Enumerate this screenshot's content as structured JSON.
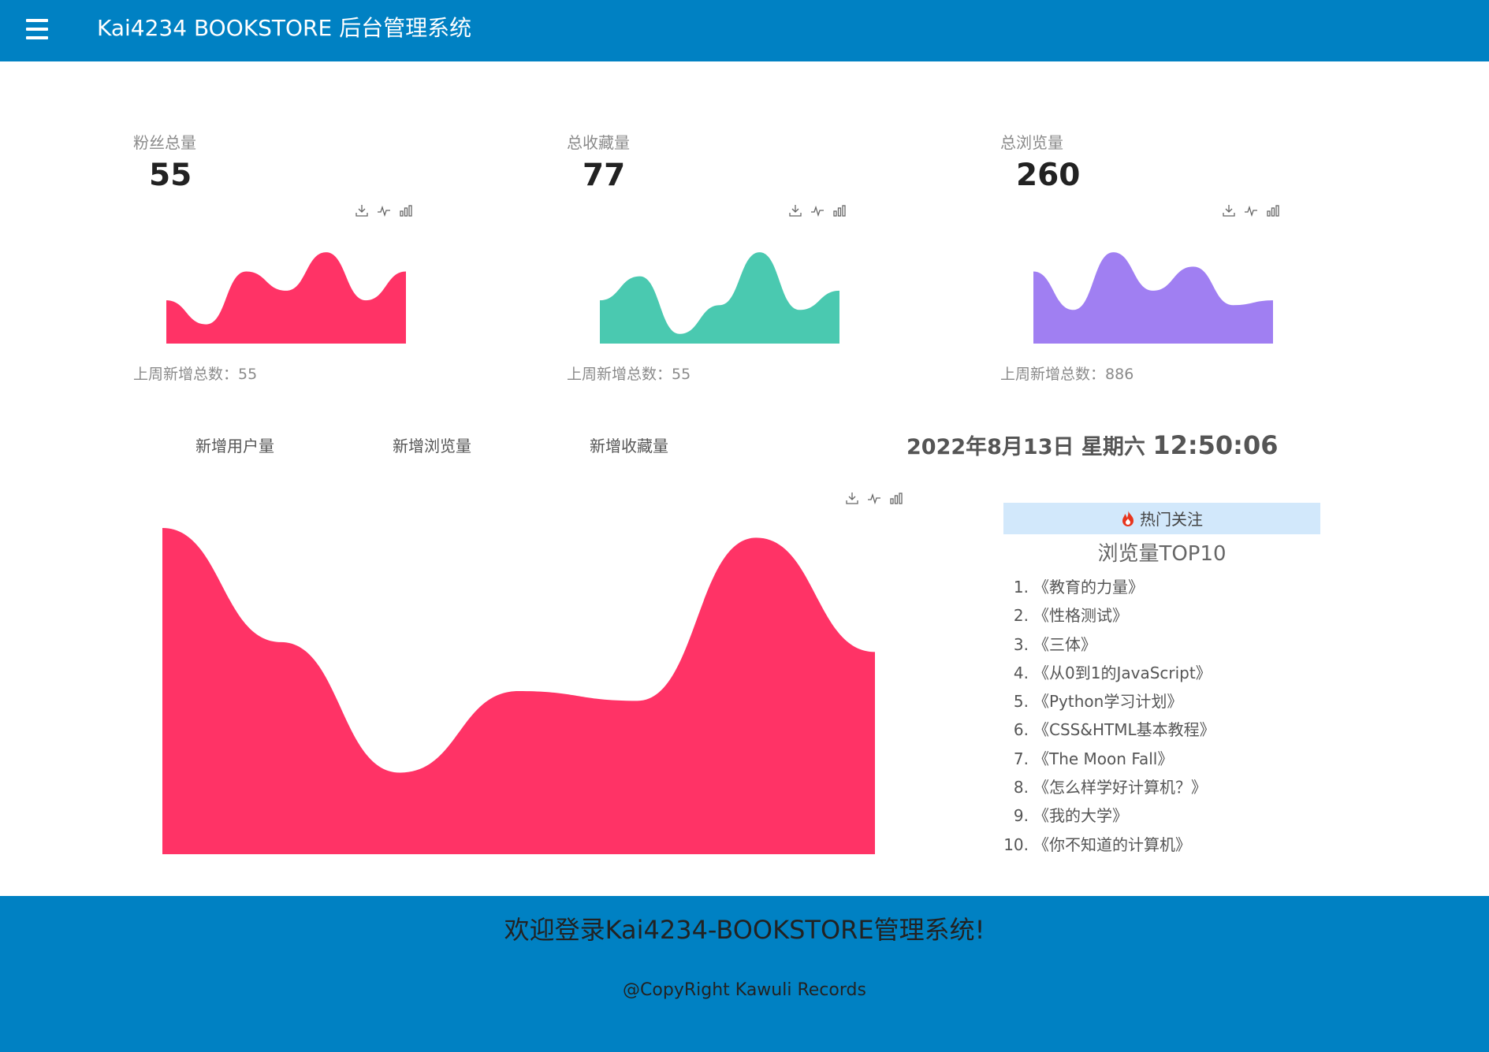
{
  "header": {
    "title": "Kai4234 BOOKSTORE 后台管理系统",
    "menu_icon": "hamburger-menu-icon"
  },
  "stats": [
    {
      "label": "粉丝总量",
      "value": "55",
      "foot_label": "上周新增总数：",
      "foot_value": "55",
      "color": "#ff3366",
      "trend": [
        0.45,
        0.2,
        0.75,
        0.55,
        0.95,
        0.45,
        0.75
      ]
    },
    {
      "label": "总收藏量",
      "value": "77",
      "foot_label": "上周新增总数：",
      "foot_value": "55",
      "color": "#4ac9b0",
      "trend": [
        0.45,
        0.7,
        0.1,
        0.4,
        0.95,
        0.35,
        0.55
      ]
    },
    {
      "label": "总浏览量",
      "value": "260",
      "foot_label": "上周新增总数：",
      "foot_value": "886",
      "color": "#a07ff2",
      "trend": [
        0.75,
        0.35,
        0.95,
        0.55,
        0.8,
        0.4,
        0.45
      ]
    }
  ],
  "toolbox_icons": [
    "download-icon",
    "line-chart-icon",
    "bar-chart-icon"
  ],
  "tabs": [
    "新增用户量",
    "新增浏览量",
    "新增收藏量"
  ],
  "datetime": {
    "date": "2022年8月13日 星期六",
    "time": "12:50:06"
  },
  "chart_data": {
    "type": "area",
    "title": "",
    "series": [
      {
        "values": [
          1.0,
          0.65,
          0.25,
          0.5,
          0.47,
          0.97,
          0.62
        ]
      }
    ],
    "color": "#ff3366",
    "ylim": [
      0,
      1
    ],
    "grid": false
  },
  "hot": {
    "header": "热门关注",
    "title": "浏览量TOP10",
    "items": [
      "《教育的力量》",
      "《性格测试》",
      "《三体》",
      "《从0到1的JavaScript》",
      "《Python学习计划》",
      "《CSS&HTML基本教程》",
      "《The Moon Fall》",
      "《怎么样学好计算机？》",
      "《我的大学》",
      "《你不知道的计算机》"
    ]
  },
  "footer": {
    "welcome": "欢迎登录Kai4234-BOOKSTORE管理系统!",
    "copyright": "@CopyRight Kawuli Records"
  }
}
